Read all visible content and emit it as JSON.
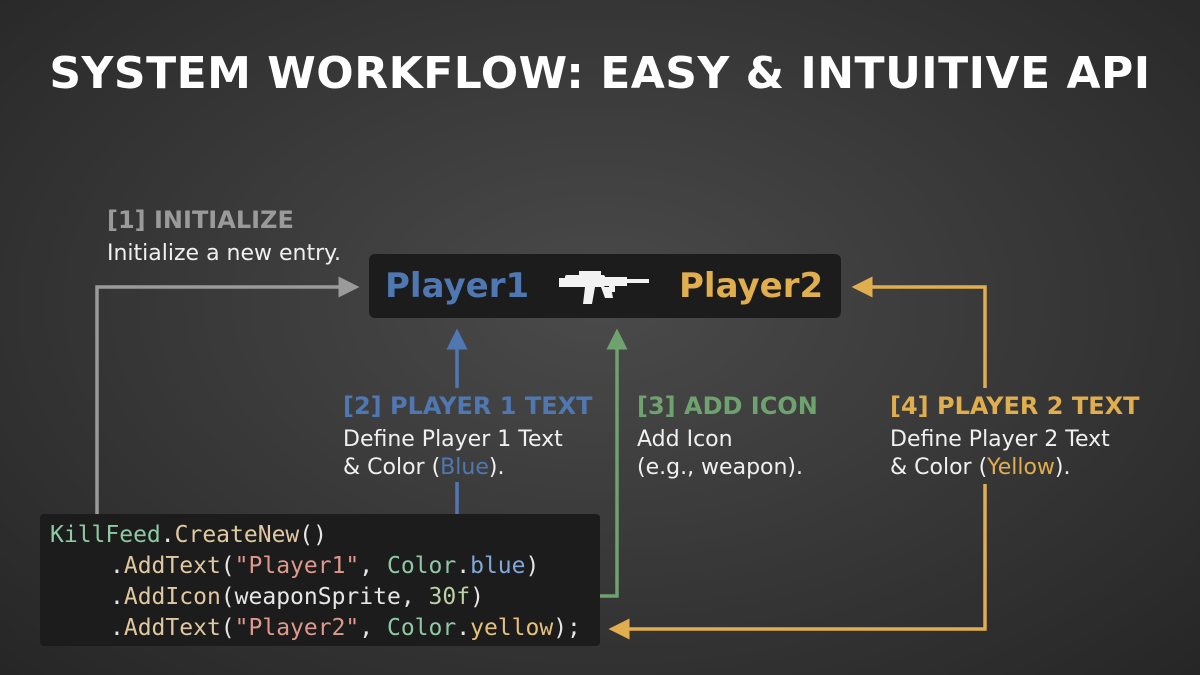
{
  "title": "SYSTEM WORKFLOW: EASY & INTUITIVE API",
  "colors": {
    "gray": "#9a9a9a",
    "blue": "#4f78b3",
    "green": "#6ea26e",
    "yellow": "#e0ae4e"
  },
  "steps": [
    {
      "title": "[1] INITIALIZE",
      "desc": [
        "Initialize a new entry."
      ]
    },
    {
      "title": "[2] PLAYER 1 TEXT",
      "desc_line1": "Define Player 1 Text",
      "desc_pre": "& Color (",
      "desc_hl": "Blue",
      "desc_post": ")."
    },
    {
      "title": "[3] ADD ICON",
      "desc": [
        "Add Icon",
        "(e.g., weapon)."
      ]
    },
    {
      "title": "[4] PLAYER 2 TEXT",
      "desc_line1": "Define Player 2 Text",
      "desc_pre": "& Color (",
      "desc_hl": "Yellow",
      "desc_post": ")."
    }
  ],
  "preview": {
    "player1": "Player1",
    "player2": "Player2",
    "icon": "weapon-icon"
  },
  "code": {
    "line1": {
      "cls": "KillFeed",
      "dot": ".",
      "fn": "CreateNew",
      "rest": "()"
    },
    "line2": {
      "dot": ".",
      "fn": "AddText",
      "open": "(",
      "str": "\"Player1\"",
      "sep": ", ",
      "cls": "Color",
      "dot2": ".",
      "val": "blue",
      "close": ")"
    },
    "line3": {
      "dot": ".",
      "fn": "AddIcon",
      "open": "(",
      "arg": "weaponSprite",
      "sep": ", ",
      "num": "30f",
      "close": ")"
    },
    "line4": {
      "dot": ".",
      "fn": "AddText",
      "open": "(",
      "str": "\"Player2\"",
      "sep": ", ",
      "cls": "Color",
      "dot2": ".",
      "val": "yellow",
      "close": ");"
    }
  }
}
